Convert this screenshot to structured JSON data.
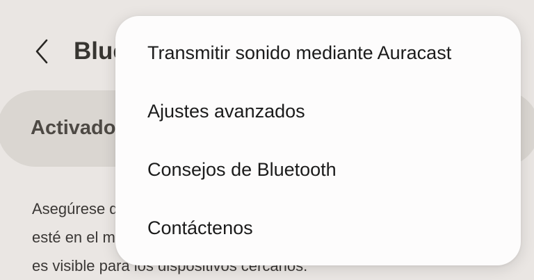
{
  "header": {
    "back_icon": "chevron-left-icon",
    "title": "Bluetooth"
  },
  "bluetooth_toggle": {
    "label": "Activado",
    "state": "on"
  },
  "info": {
    "line1": "Asegúrese de que el dispositivo al que desea conectarse",
    "line2": "esté en el modo de emparejamiento. Su teléfono",
    "line3": "es visible para los dispositivos cercanos."
  },
  "menu": {
    "items": [
      {
        "label": "Transmitir sonido mediante Auracast"
      },
      {
        "label": "Ajustes avanzados"
      },
      {
        "label": "Consejos de Bluetooth"
      },
      {
        "label": "Contáctenos"
      }
    ]
  }
}
